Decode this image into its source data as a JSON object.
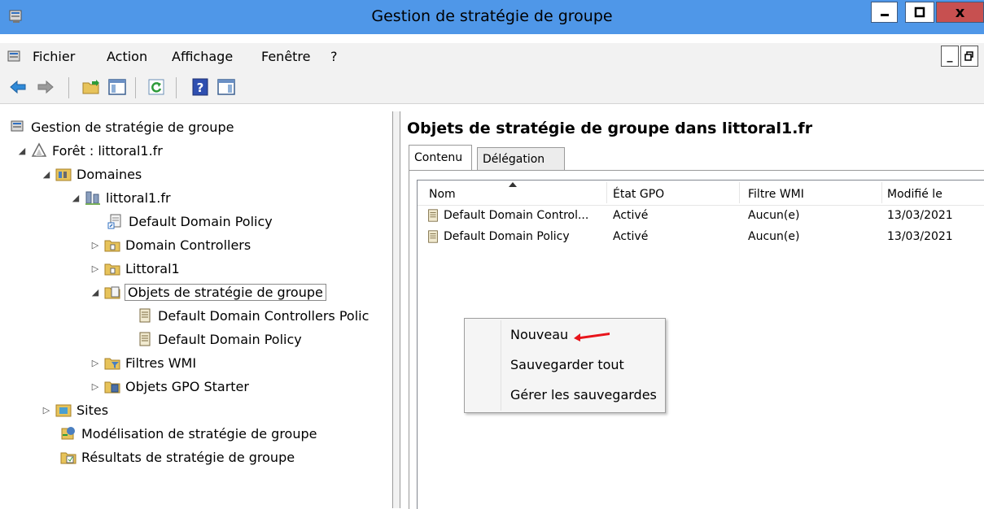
{
  "window": {
    "title": "Gestion de stratégie de groupe",
    "minimize": "▁",
    "maximize": "▢",
    "close": "x"
  },
  "menubar": {
    "items": [
      "Fichier",
      "Action",
      "Affichage",
      "Fenêtre",
      "?"
    ],
    "mdi_minimize": "_",
    "mdi_restore": "🗗"
  },
  "toolbar": {
    "buttons": [
      "back-icon",
      "forward-icon",
      "up-folder-icon",
      "show-hide-tree-icon",
      "refresh-icon",
      "help-icon",
      "show-action-pane-icon"
    ]
  },
  "tree": {
    "root": "Gestion de stratégie de groupe",
    "forest": "Forêt : littoral1.fr",
    "domains": "Domaines",
    "domain": "littoral1.fr",
    "default_domain_policy": "Default Domain Policy",
    "domain_controllers": "Domain Controllers",
    "littoral1": "Littoral1",
    "gpo_objects": "Objets de stratégie de groupe",
    "gpo_ddcp": "Default Domain Controllers Polic",
    "gpo_ddp": "Default Domain Policy",
    "wmi_filters": "Filtres WMI",
    "starter_gpos": "Objets GPO Starter",
    "sites": "Sites",
    "modeling": "Modélisation de stratégie de groupe",
    "results": "Résultats de stratégie de groupe",
    "selected": "Objets de stratégie de groupe"
  },
  "right": {
    "heading": "Objets de stratégie de groupe dans littoral1.fr",
    "tabs": [
      "Contenu",
      "Délégation"
    ],
    "active_tab": "Contenu",
    "columns": [
      "Nom",
      "État GPO",
      "Filtre WMI",
      "Modifié le"
    ],
    "sort_column": "Nom",
    "rows": [
      {
        "name": "Default Domain Control...",
        "state": "Activé",
        "wmi": "Aucun(e)",
        "modified": "13/03/2021"
      },
      {
        "name": "Default Domain Policy",
        "state": "Activé",
        "wmi": "Aucun(e)",
        "modified": "13/03/2021"
      }
    ]
  },
  "context_menu": {
    "items": [
      "Nouveau",
      "Sauvegarder tout",
      "Gérer les sauvegardes"
    ],
    "highlighted": "Nouveau",
    "annotation_color": "#e8141b"
  }
}
